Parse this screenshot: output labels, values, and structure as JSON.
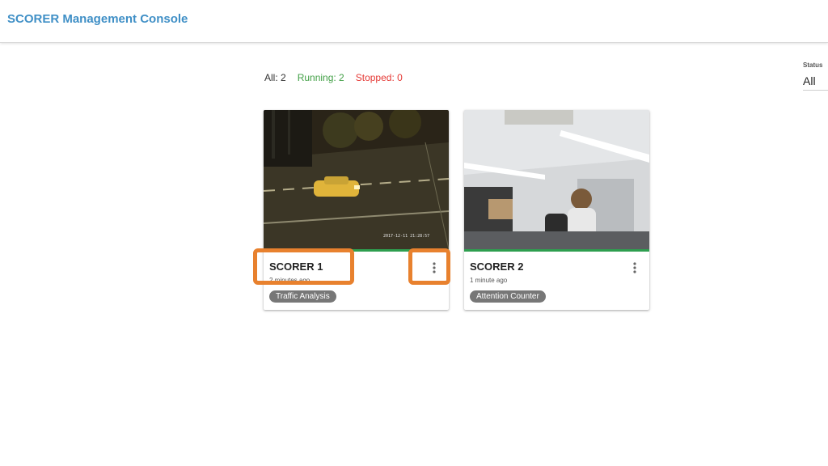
{
  "header": {
    "title": "SCORER Management Console"
  },
  "summary": {
    "all": "All: 2",
    "running": "Running: 2",
    "stopped": "Stopped: 0"
  },
  "status_filter": {
    "label": "Status",
    "value": "All"
  },
  "colors": {
    "title": "#3f8fc6",
    "running": "#43a047",
    "stopped": "#e53935",
    "highlight": "#e8812e",
    "tag_bg": "#777777"
  },
  "cards": [
    {
      "name": "SCORER 1",
      "time": "2 minutes ago",
      "tag": "Traffic Analysis",
      "timestamp_overlay": "2017-12-11 21:28:57",
      "status_color": "#2e9e4f",
      "menu_icon": "more-vert-icon"
    },
    {
      "name": "SCORER 2",
      "time": "1 minute ago",
      "tag": "Attention Counter",
      "status_color": "#2e9e4f",
      "menu_icon": "more-vert-icon"
    }
  ]
}
